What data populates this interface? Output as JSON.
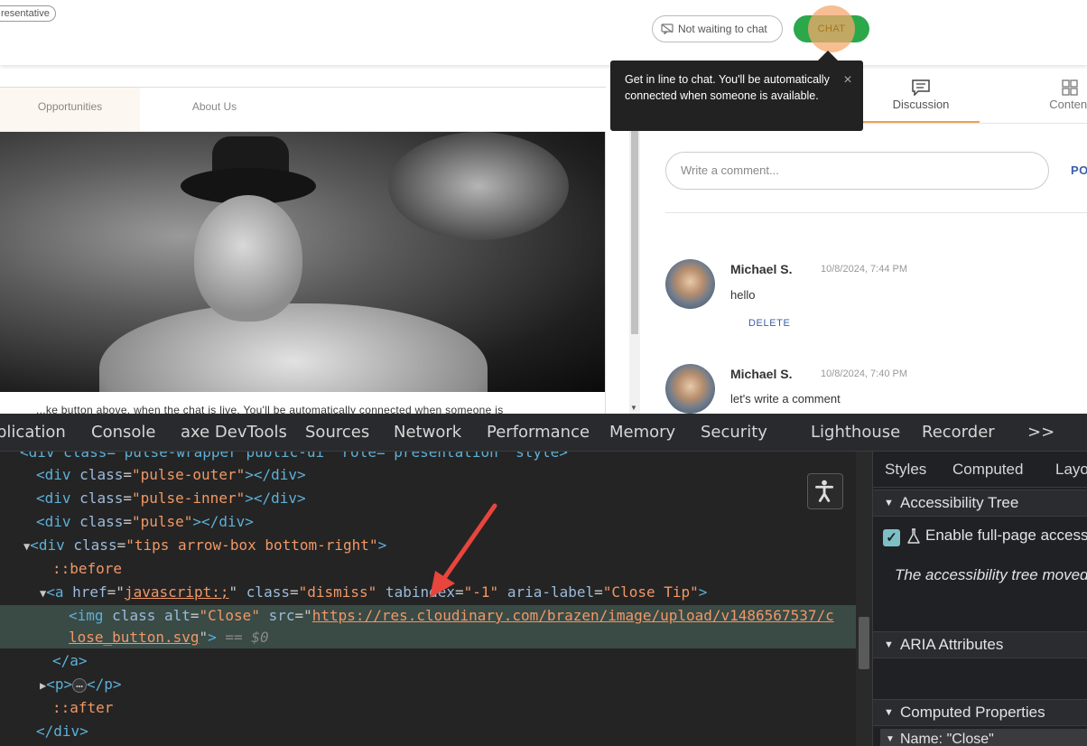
{
  "site": {
    "rep_badge": "resentative",
    "not_waiting_label": "Not waiting to chat",
    "chat_label": "CHAT",
    "nav_tabs": [
      "Opportunities",
      "About Us"
    ],
    "cut_text": "...ke button above, when the chat is live. You'll be automatically connected when someone is",
    "tooltip": {
      "text": "Get in line to chat. You'll be automatically connected when someone is available.",
      "close_glyph": "×"
    },
    "right_tabs": {
      "discussion": "Discussion",
      "content": "Content"
    },
    "comment_placeholder": "Write a comment...",
    "post_label": "PO",
    "comments": [
      {
        "name": "Michael S.",
        "date": "10/8/2024, 7:44 PM",
        "text": "hello",
        "delete": "DELETE"
      },
      {
        "name": "Michael S.",
        "date": "10/8/2024, 7:40 PM",
        "text": "let's write a comment"
      }
    ]
  },
  "devtools": {
    "tabs": [
      "plication",
      "Console",
      "axe DevTools",
      "Sources",
      "Network",
      "Performance",
      "Memory",
      "Security",
      "Lighthouse",
      "Recorder",
      ">>"
    ],
    "side_tabs": [
      "Styles",
      "Computed",
      "Layo"
    ],
    "sections": {
      "tree": "Accessibility Tree",
      "aria": "ARIA Attributes",
      "computed": "Computed Properties"
    },
    "enable_label": "Enable full-page access",
    "moved_text": "The accessibility tree moved",
    "name_row": "Name: \"Close\"",
    "code": {
      "l0_tag": "<div class=\"pulse-wrapper public-ui\" role=\"presentation\" style>",
      "l1_tag": "div",
      "l1_attr": "class",
      "l1_val": "\"pulse-outer\"",
      "l2_val": "\"pulse-inner\"",
      "l3_val": "\"pulse\"",
      "l4_val": "\"tips arrow-box bottom-right\"",
      "before": "::before",
      "a_href": "javascript:;",
      "a_class": "\"dismiss\"",
      "a_tab": "\"-1\"",
      "a_aria": "\"Close Tip\"",
      "img_alt": "\"Close\"",
      "img_src_1": "https://res.cloudinary.com/brazen/image/upload/v1486567537/c",
      "img_src_2": "lose_button.svg",
      "eq": "== $0",
      "after": "::after",
      "ellipsis": "…"
    }
  },
  "colors": {
    "chat_green": "#2ba84a",
    "pulse": "#f4a86e",
    "accent_tab": "#f0a04b",
    "link_blue": "#3b5ea8",
    "arrow_red": "#e8453c"
  }
}
